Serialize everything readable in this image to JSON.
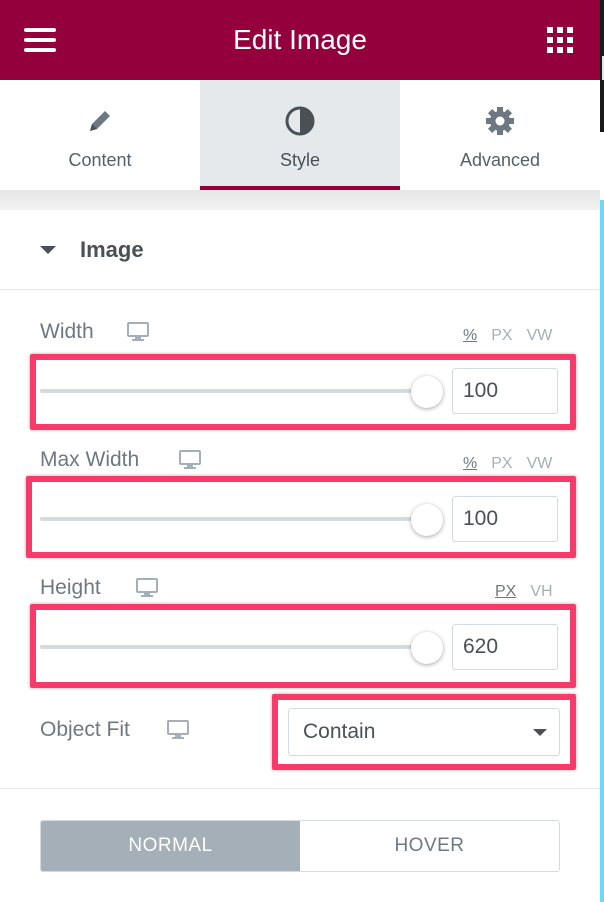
{
  "header": {
    "title": "Edit Image",
    "menu_icon": "hamburger-icon",
    "apps_icon": "grid-icon"
  },
  "tabs": [
    {
      "label": "Content",
      "icon": "pencil-icon",
      "active": false
    },
    {
      "label": "Style",
      "icon": "half-circle-icon",
      "active": true
    },
    {
      "label": "Advanced",
      "icon": "gear-icon",
      "active": false
    }
  ],
  "section": {
    "title": "Image",
    "expanded": true
  },
  "controls": {
    "width": {
      "label": "Width",
      "value": "100",
      "units": [
        "%",
        "PX",
        "VW"
      ],
      "active_unit": "%"
    },
    "max_width": {
      "label": "Max Width",
      "value": "100",
      "units": [
        "%",
        "PX",
        "VW"
      ],
      "active_unit": "%"
    },
    "height": {
      "label": "Height",
      "value": "620",
      "units": [
        "PX",
        "VH"
      ],
      "active_unit": "PX"
    },
    "object_fit": {
      "label": "Object Fit",
      "value": "Contain"
    }
  },
  "state_toggle": {
    "normal": "NORMAL",
    "hover": "HOVER",
    "active": "normal"
  },
  "colors": {
    "header_bg": "#93003c",
    "highlight": "#f63b6a",
    "active_tab_bg": "#e6e9ec",
    "toggle_active": "#a4afb7"
  }
}
